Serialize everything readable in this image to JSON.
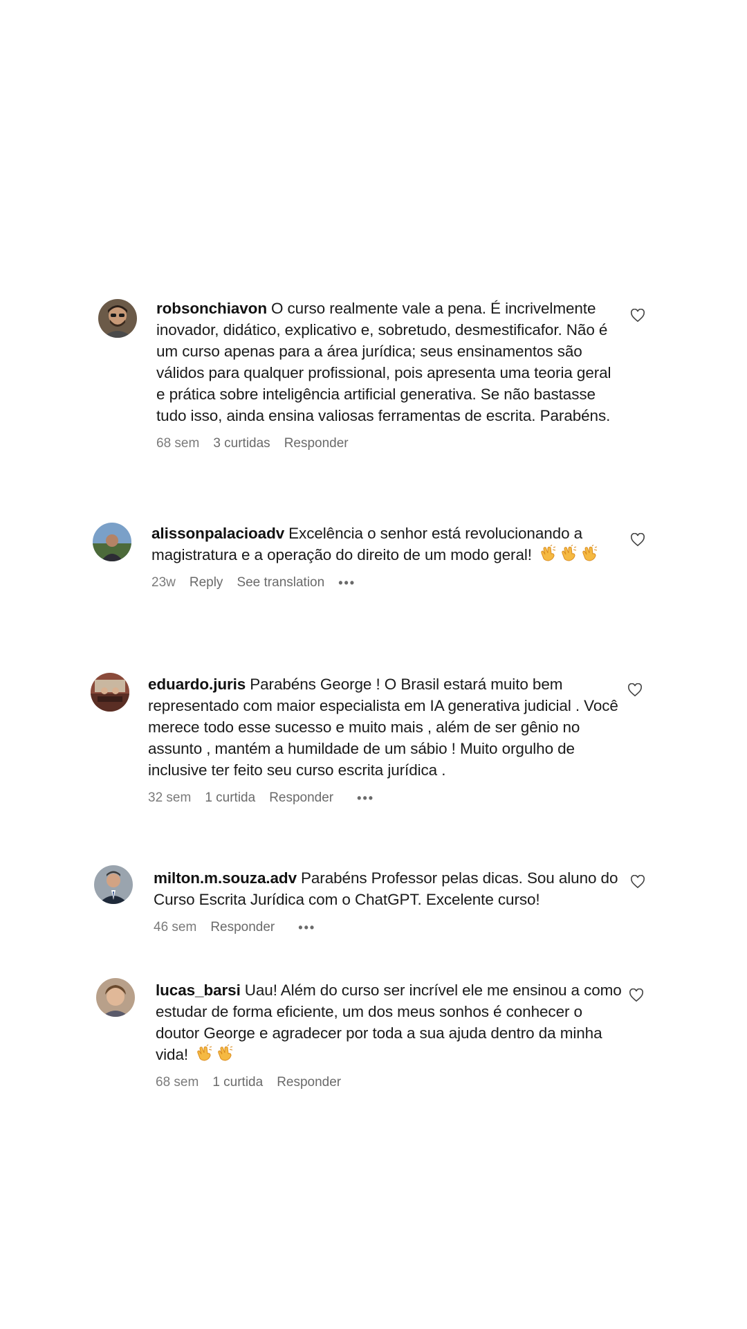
{
  "comments": [
    {
      "username": "robsonchiavon",
      "text": "O curso realmente vale a pena. É incrivelmente inovador, didático, explicativo e, sobretudo, desmestificafor. Não é um curso apenas para a área jurídica; seus ensinamentos são válidos para qualquer profissional, pois apresenta uma teoria geral e prática sobre inteligência artificial generativa. Se não bastasse tudo isso, ainda ensina valiosas ferramentas de escrita. Parabéns.",
      "time": "68 sem",
      "likes": "3 curtidas",
      "reply": "Responder",
      "avatar_icon": "avatar-man-beard-glasses"
    },
    {
      "username": "alissonpalacioadv",
      "text": "Excelência o senhor está revolucionando a magistratura e a operação do direito de um modo geral!",
      "emojis": [
        "clapping-hands-icon",
        "clapping-hands-icon",
        "clapping-hands-icon"
      ],
      "time": "23w",
      "reply": "Reply",
      "translation": "See translation",
      "more": "•••",
      "avatar_icon": "avatar-man-outdoors"
    },
    {
      "username": "eduardo.juris",
      "text": "Parabéns George ! O Brasil estará muito bem representado com maior especialista em IA generativa judicial . Você merece todo esse sucesso e muito mais , além de ser gênio no assunto , mantém a humildade de um sábio ! Muito orgulho de inclusive ter feito seu curso escrita jurídica .",
      "time": "32 sem",
      "likes": "1 curtida",
      "reply": "Responder",
      "more": "•••",
      "avatar_icon": "avatar-office-photo"
    },
    {
      "username": "milton.m.souza.adv",
      "text": "Parabéns Professor pelas dicas. Sou aluno do Curso Escrita Jurídica com o ChatGPT. Excelente curso!",
      "time": "46 sem",
      "reply": "Responder",
      "more": "•••",
      "avatar_icon": "avatar-man-suit"
    },
    {
      "username": "lucas_barsi",
      "text": "Uau! Além do curso ser incrível ele me ensinou a como estudar de forma eficiente, um dos meus sonhos é conhecer o doutor George e agradecer por toda a sua ajuda dentro da minha vida!",
      "emojis": [
        "clapping-hands-icon",
        "clapping-hands-icon"
      ],
      "time": "68 sem",
      "likes": "1 curtida",
      "reply": "Responder",
      "avatar_icon": "avatar-young-man"
    }
  ],
  "colors": {
    "text": "#1a1a1a",
    "meta": "#7a7a7a",
    "emoji": "#f5b942"
  }
}
